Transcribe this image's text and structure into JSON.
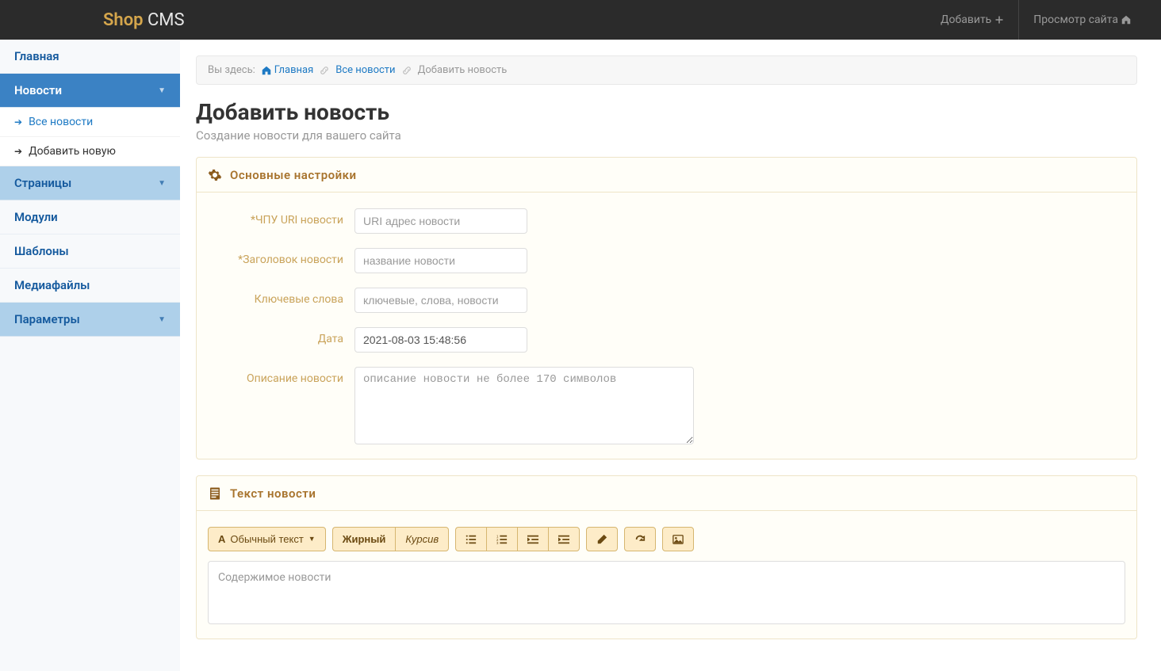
{
  "header": {
    "logo_shop": "Shop",
    "logo_cms": " CMS",
    "add_label": "Добавить",
    "view_site_label": "Просмотр сайта"
  },
  "sidebar": {
    "items": [
      {
        "label": "Главная",
        "type": "plain"
      },
      {
        "label": "Новости",
        "type": "active",
        "caret": true
      },
      {
        "label": "Страницы",
        "type": "group",
        "caret": true
      },
      {
        "label": "Модули",
        "type": "plain"
      },
      {
        "label": "Шаблоны",
        "type": "plain"
      },
      {
        "label": "Медиафайлы",
        "type": "plain"
      },
      {
        "label": "Параметры",
        "type": "group",
        "caret": true
      }
    ],
    "subnav": [
      {
        "label": "Все новости",
        "kind": "link"
      },
      {
        "label": "Добавить новую",
        "kind": "dark"
      }
    ]
  },
  "breadcrumb": {
    "prefix": "Вы здесь:",
    "home": "Главная",
    "all_news": "Все новости",
    "current": "Добавить новость"
  },
  "page": {
    "title": "Добавить новость",
    "subtitle": "Создание новости для вашего сайта"
  },
  "panel_main": {
    "title": "Основные настройки",
    "fields": {
      "uri_label": "*ЧПУ URI новости",
      "uri_placeholder": "URI адрес новости",
      "title_label": "*Заголовок новости",
      "title_placeholder": "название новости",
      "keywords_label": "Ключевые слова",
      "keywords_placeholder": "ключевые, слова, новости",
      "date_label": "Дата",
      "date_value": "2021-08-03 15:48:56",
      "desc_label": "Описание новости",
      "desc_placeholder": "описание новости не более 170 символов"
    }
  },
  "panel_text": {
    "title": "Текст новости",
    "toolbar": {
      "style_label": "Обычный текст",
      "bold": "Жирный",
      "italic": "Курсив"
    },
    "content_placeholder": "Содержимое новости"
  }
}
